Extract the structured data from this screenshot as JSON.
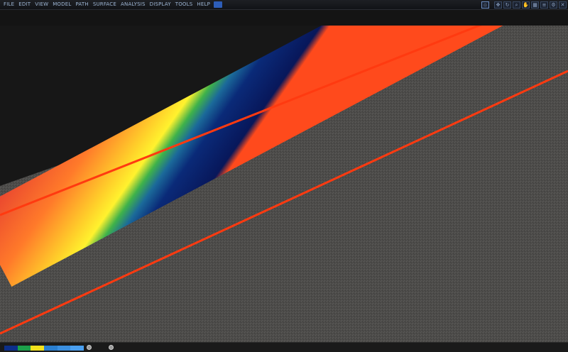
{
  "menubar": {
    "items": [
      "FILE",
      "EDIT",
      "VIEW",
      "MODEL",
      "PATH",
      "SURFACE",
      "ANALYSIS",
      "DISPLAY",
      "TOOLS",
      "HELP"
    ],
    "accent_color": "#2d5db8"
  },
  "toolbar": {
    "buttons": [
      {
        "icon": "select-icon",
        "glyph": "▫"
      },
      {
        "icon": "move-icon",
        "glyph": "✥"
      },
      {
        "icon": "rotate-icon",
        "glyph": "↻"
      },
      {
        "icon": "zoom-icon",
        "glyph": "⌕"
      },
      {
        "icon": "pan-icon",
        "glyph": "✋"
      },
      {
        "icon": "grid-icon",
        "glyph": "▦"
      },
      {
        "icon": "layers-icon",
        "glyph": "≡"
      },
      {
        "icon": "settings-icon",
        "glyph": "⚙"
      },
      {
        "icon": "close-icon",
        "glyph": "✕"
      }
    ]
  },
  "info": {
    "line1": "",
    "line2": "",
    "line3": ""
  },
  "viewport": {
    "background_color": "#171717",
    "terrain_color": "#4d4c4a",
    "band_colors": [
      "#ff4a1c",
      "#e9452f",
      "#ff7a2a",
      "#ffd02a",
      "#fff22e",
      "#3fb24a",
      "#1b6a9a",
      "#0a2a78",
      "#08175a",
      "#ff4a1c"
    ]
  },
  "statusbar": {
    "legend_colors": [
      "#0c2f8a",
      "#1ca04a",
      "#f2e21c",
      "#2a7fd0",
      "#3a8fe0",
      "#4a9ff0"
    ]
  }
}
